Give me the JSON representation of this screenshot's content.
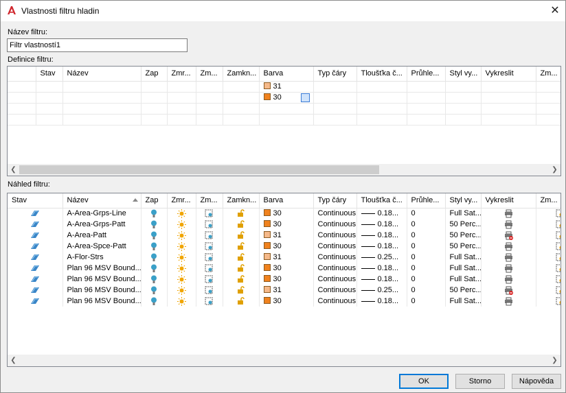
{
  "window": {
    "title": "Vlastnosti filtru hladin",
    "close": "✕"
  },
  "filter_name": {
    "label": "Název filtru:",
    "value": "Filtr vlastností1"
  },
  "definition": {
    "label": "Definice filtru:",
    "columns": [
      "",
      "Stav",
      "Název",
      "Zap",
      "Zmr...",
      "Zm...",
      "Zamkn...",
      "Barva",
      "Typ čáry",
      "Tloušťka č...",
      "Průhle...",
      "Styl vy...",
      "Vykreslit",
      "Zm..."
    ],
    "rows": [
      {
        "color_label": "31",
        "color_hex": "#f5b98a",
        "picker": true
      },
      {
        "color_label": "30",
        "color_hex": "#f0821e",
        "picker": true
      },
      {
        "color_label": "",
        "color_hex": "",
        "picker": false
      }
    ]
  },
  "preview": {
    "label": "Náhled filtru:",
    "columns": [
      "Stav",
      "Název",
      "Zap",
      "Zmr...",
      "Zm...",
      "Zamkn...",
      "Barva",
      "Typ čáry",
      "Tloušťka č...",
      "Průhle...",
      "Styl vy...",
      "Vykreslit",
      "Zm..."
    ],
    "rows": [
      {
        "name": "A-Area-Grps-Line",
        "color_label": "30",
        "color_hex": "#f0821e",
        "linetype": "Continuous",
        "lineweight": "0.18...",
        "transparency": "0",
        "plotstyle": "Full Sat...",
        "plot_disabled": false
      },
      {
        "name": "A-Area-Grps-Patt",
        "color_label": "30",
        "color_hex": "#f0821e",
        "linetype": "Continuous",
        "lineweight": "0.18...",
        "transparency": "0",
        "plotstyle": "50 Perc...",
        "plot_disabled": false
      },
      {
        "name": "A-Area-Patt",
        "color_label": "31",
        "color_hex": "#f5b98a",
        "linetype": "Continuous",
        "lineweight": "0.18...",
        "transparency": "0",
        "plotstyle": "50 Perc...",
        "plot_disabled": true
      },
      {
        "name": "A-Area-Spce-Patt",
        "color_label": "30",
        "color_hex": "#f0821e",
        "linetype": "Continuous",
        "lineweight": "0.18...",
        "transparency": "0",
        "plotstyle": "50 Perc...",
        "plot_disabled": false
      },
      {
        "name": "A-Flor-Strs",
        "color_label": "31",
        "color_hex": "#f5b98a",
        "linetype": "Continuous",
        "lineweight": "0.25...",
        "transparency": "0",
        "plotstyle": "Full Sat...",
        "plot_disabled": false
      },
      {
        "name": "Plan 96 MSV Bound...",
        "color_label": "30",
        "color_hex": "#f0821e",
        "linetype": "Continuous",
        "lineweight": "0.18...",
        "transparency": "0",
        "plotstyle": "Full Sat...",
        "plot_disabled": false
      },
      {
        "name": "Plan 96 MSV Bound...",
        "color_label": "30",
        "color_hex": "#f0821e",
        "linetype": "Continuous",
        "lineweight": "0.18...",
        "transparency": "0",
        "plotstyle": "Full Sat...",
        "plot_disabled": false
      },
      {
        "name": "Plan 96 MSV Bound...",
        "color_label": "31",
        "color_hex": "#f5b98a",
        "linetype": "Continuous",
        "lineweight": "0.25...",
        "transparency": "0",
        "plotstyle": "50 Perc...",
        "plot_disabled": true
      },
      {
        "name": "Plan 96 MSV Bound...",
        "color_label": "30",
        "color_hex": "#f0821e",
        "linetype": "Continuous",
        "lineweight": "0.18...",
        "transparency": "0",
        "plotstyle": "Full Sat...",
        "plot_disabled": false
      }
    ]
  },
  "buttons": {
    "ok": "OK",
    "cancel": "Storno",
    "help": "Nápověda"
  },
  "colors": {
    "layer_on": "#3aa0c8",
    "freeze_sun": "#f0a500",
    "lock": "#e0a000",
    "status_layer": "#3a86c8"
  }
}
